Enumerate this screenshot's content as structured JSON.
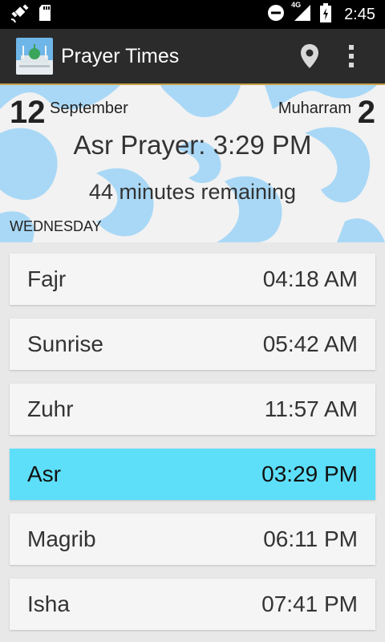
{
  "status_bar": {
    "time": "2:45",
    "network": "4G",
    "icons": [
      "gps-icon",
      "sd-card-icon",
      "do-not-disturb-icon",
      "signal-icon",
      "battery-charging-icon"
    ]
  },
  "app_bar": {
    "title": "Prayer Times",
    "actions": [
      "location-pin-icon",
      "overflow-menu-icon"
    ]
  },
  "header": {
    "gregorian_day": "12",
    "gregorian_month": "September",
    "hijri_month": "Muharram",
    "hijri_day": "2",
    "next_prayer": "Asr Prayer: 3:29 PM",
    "remaining": "44 minutes remaining",
    "weekday": "WEDNESDAY"
  },
  "prayers": [
    {
      "name": "Fajr",
      "time": "04:18 AM",
      "active": false
    },
    {
      "name": "Sunrise",
      "time": "05:42 AM",
      "active": false
    },
    {
      "name": "Zuhr",
      "time": "11:57 AM",
      "active": false
    },
    {
      "name": "Asr",
      "time": "03:29 PM",
      "active": true
    },
    {
      "name": "Magrib",
      "time": "06:11 PM",
      "active": false
    },
    {
      "name": "Isha",
      "time": "07:41 PM",
      "active": false
    }
  ],
  "colors": {
    "accent_active": "#5ddffa",
    "pattern": "#a9d8f6",
    "app_bar": "#2b2b2b"
  }
}
